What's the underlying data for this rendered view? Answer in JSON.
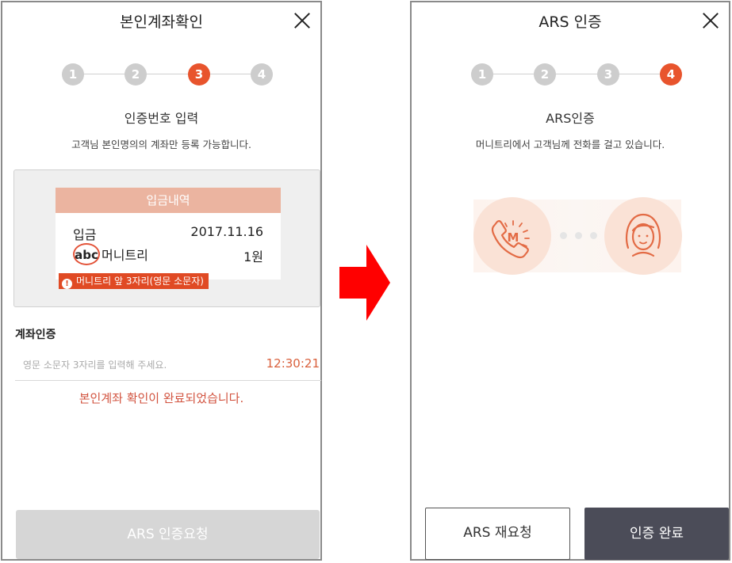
{
  "left": {
    "title": "본인계좌확인",
    "steps": [
      "1",
      "2",
      "3",
      "4"
    ],
    "active_step": 3,
    "subheading": "인증번호 입력",
    "description": "고객님 본인명의의 계좌만 등록 가능합니다.",
    "deposit": {
      "header": "입금내역",
      "label_in": "입금",
      "date": "2017.11.16",
      "code": "abc",
      "name": "머니트리",
      "amount": "1원",
      "hint": "머니트리 앞 3자리(영문 소문자)",
      "hint_icon": "!"
    },
    "account_auth_label": "계좌인증",
    "input_placeholder": "영문 소문자 3자리를 입력해 주세요.",
    "timer": "12:30:21",
    "success_message": "본인계좌 확인이 완료되었습니다.",
    "ars_request_button": "ARS 인증요청"
  },
  "right": {
    "title": "ARS 인증",
    "steps": [
      "1",
      "2",
      "3",
      "4"
    ],
    "active_step": 4,
    "subheading": "ARS인증",
    "description": "머니트리에서 고객님께 전화를 걸고 있습니다.",
    "phone_letter": "M",
    "retry_button": "ARS 재요청",
    "complete_button": "인증 완료"
  },
  "colors": {
    "accent": "#e8542d",
    "step_inactive": "#cdcdcd",
    "arrow": "#ff0000",
    "dark_button": "#4b4c58",
    "success_text": "#d2533f"
  },
  "icons": {
    "close": "close-icon",
    "arrow": "arrow-right-icon",
    "phone": "phone-call-icon",
    "user": "user-face-icon",
    "warning": "exclamation-icon"
  }
}
